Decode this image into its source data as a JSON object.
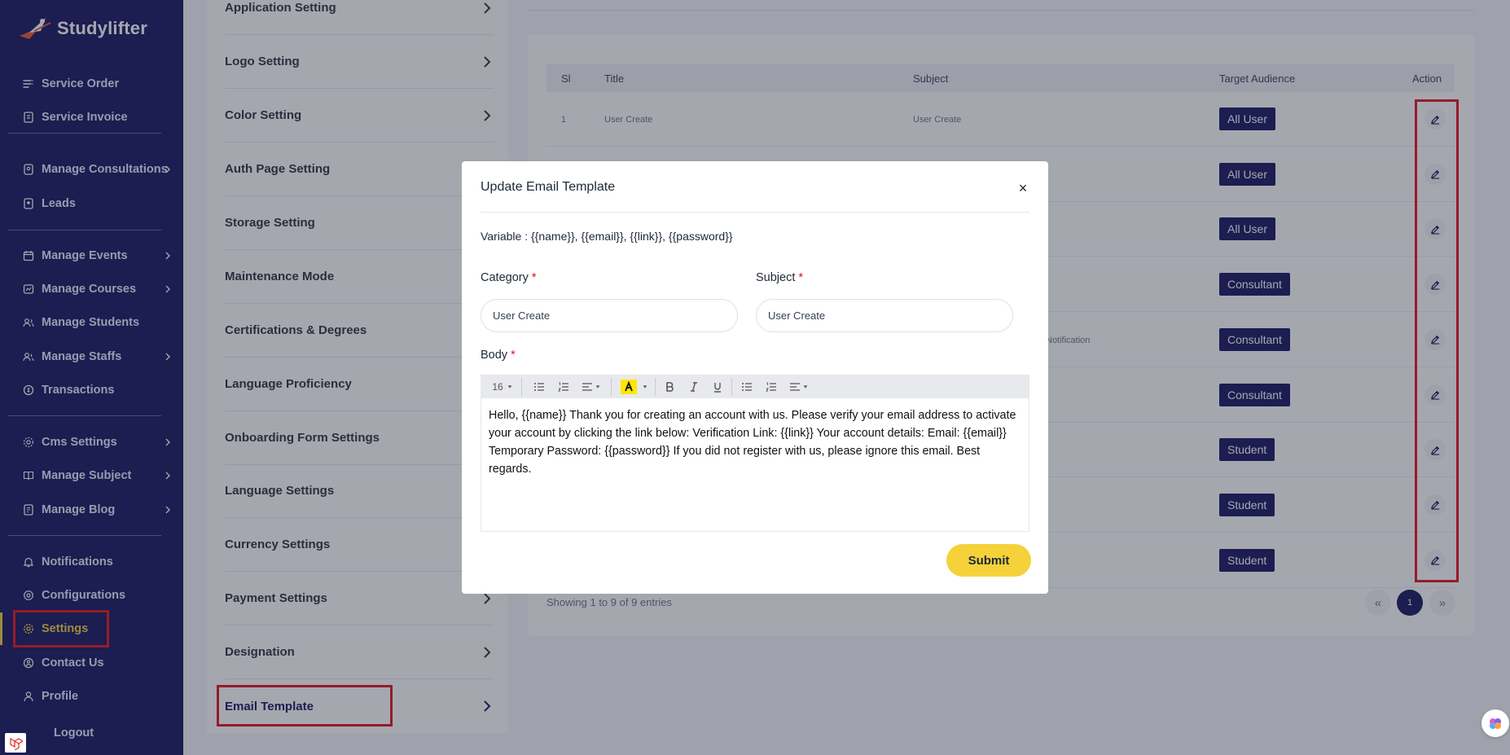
{
  "brand": {
    "name": "Studylifter"
  },
  "sidebar": {
    "items": [
      {
        "label": "Service Order",
        "icon": "list-icon"
      },
      {
        "label": "Service Invoice",
        "icon": "invoice-icon"
      },
      {
        "label": "Manage Consultations",
        "icon": "consultation-icon"
      },
      {
        "label": "Leads",
        "icon": "leads-icon"
      },
      {
        "label": "Manage Events",
        "icon": "calendar-icon"
      },
      {
        "label": "Manage Courses",
        "icon": "course-icon"
      },
      {
        "label": "Manage Students",
        "icon": "students-icon"
      },
      {
        "label": "Manage Staffs",
        "icon": "staff-icon"
      },
      {
        "label": "Transactions",
        "icon": "transaction-icon"
      },
      {
        "label": "Cms Settings",
        "icon": "cms-icon"
      },
      {
        "label": "Manage Subject",
        "icon": "subject-icon"
      },
      {
        "label": "Manage Blog",
        "icon": "blog-icon"
      },
      {
        "label": "Notifications",
        "icon": "bell-icon"
      },
      {
        "label": "Configurations",
        "icon": "config-icon"
      },
      {
        "label": "Settings",
        "icon": "gear-icon"
      },
      {
        "label": "Contact Us",
        "icon": "contact-icon"
      },
      {
        "label": "Profile",
        "icon": "user-icon"
      },
      {
        "label": "Logout",
        "icon": "logout-icon"
      }
    ]
  },
  "settings_menu": {
    "items": [
      "Application Setting",
      "Logo Setting",
      "Color Setting",
      "Auth Page Setting",
      "Storage Setting",
      "Maintenance Mode",
      "Certifications & Degrees",
      "Language Proficiency",
      "Onboarding Form Settings",
      "Language Settings",
      "Currency Settings",
      "Payment Settings",
      "Designation",
      "Email Template"
    ]
  },
  "table": {
    "headers": {
      "sl": "Sl",
      "title": "Title",
      "subject": "Subject",
      "audience": "Target Audience",
      "action": "Action"
    },
    "rows": [
      {
        "sl": "1",
        "title": "User Create",
        "subject": "User Create",
        "audience": "All User"
      },
      {
        "sl": "",
        "title": "",
        "subject": "",
        "audience": "All User"
      },
      {
        "sl": "",
        "title": "",
        "subject": "",
        "audience": "All User"
      },
      {
        "sl": "",
        "title": "",
        "subject": "",
        "audience": "Consultant"
      },
      {
        "sl": "",
        "title": "",
        "subject": "",
        "audience": "Consultant"
      },
      {
        "sl": "",
        "title": "",
        "subject": "",
        "audience": "Consultant"
      },
      {
        "sl": "",
        "title": "",
        "subject": "",
        "audience": "Student"
      },
      {
        "sl": "",
        "title": "",
        "subject": "",
        "audience": "Student"
      },
      {
        "sl": "",
        "title": "",
        "subject": "",
        "audience": "Student"
      }
    ],
    "partial_text": "Notification",
    "entries": "Showing 1 to 9 of 9 entries",
    "pagination": {
      "prev": "«",
      "current": "1",
      "next": "»"
    }
  },
  "modal": {
    "title": "Update Email Template",
    "close": "×",
    "variables": "Variable : {{name}}, {{email}}, {{link}}, {{password}}",
    "category_label": "Category",
    "subject_label": "Subject",
    "required_mark": "*",
    "category_value": "User Create",
    "subject_value": "User Create",
    "body_label": "Body",
    "toolbar": {
      "font_size": "16"
    },
    "body_text": "Hello, {{name}} Thank you for creating an account with us. Please verify your email address to activate your account by clicking the link below: Verification Link: {{link}} Your account details: Email: {{email}} Temporary Password: {{password}} If you did not register with us, please ignore this email. Best regards.",
    "submit": "Submit"
  },
  "colors": {
    "sidebar": "#13125c",
    "accent": "#f2cf3c",
    "badge": "#13125c",
    "highlight": "#e3111b"
  }
}
